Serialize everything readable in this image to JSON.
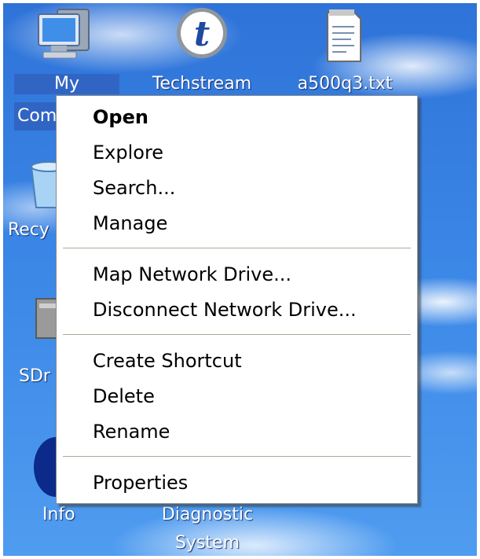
{
  "desktop": {
    "icons": [
      {
        "label_line1": "My",
        "label_line2": "Com",
        "icon": "my-computer-icon"
      },
      {
        "label": "Techstream",
        "icon": "techstream-icon"
      },
      {
        "label": "a500q3.txt",
        "icon": "text-file-icon"
      },
      {
        "label": "Recy",
        "icon": "recycle-bin-icon"
      },
      {
        "label": "SDr",
        "icon": "sdrive-icon"
      },
      {
        "label": "Info",
        "icon": "info-icon"
      },
      {
        "label_line1": "Diagnostic",
        "label_line2": "System",
        "icon": "diagnostic-system-icon"
      }
    ]
  },
  "context_menu": {
    "items": [
      {
        "label": "Open",
        "bold": true
      },
      {
        "label": "Explore"
      },
      {
        "label": "Search..."
      },
      {
        "label": "Manage"
      },
      {
        "label": "Map Network Drive..."
      },
      {
        "label": "Disconnect Network Drive..."
      },
      {
        "label": "Create Shortcut"
      },
      {
        "label": "Delete"
      },
      {
        "label": "Rename"
      },
      {
        "label": "Properties"
      }
    ]
  },
  "colors": {
    "selection": "#3165c4",
    "menu_background": "#ffffff",
    "separator": "#aca899",
    "desktop_sky": "#3a86e6"
  }
}
